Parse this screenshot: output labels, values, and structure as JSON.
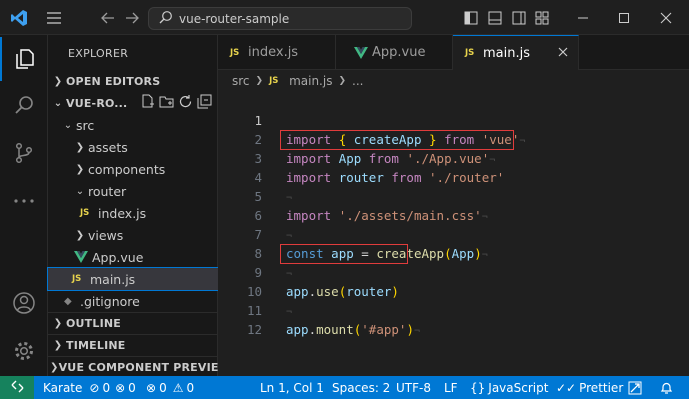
{
  "titlebar": {
    "search_text": "vue-router-sample",
    "icons": [
      "vscode-logo-icon",
      "menu-icon",
      "back-arrow-icon",
      "forward-arrow-icon",
      "search-icon",
      "toggle-sidebar-icon",
      "toggle-panel-icon",
      "toggle-secondary-sidebar-icon",
      "customize-layout-icon",
      "minimize-icon",
      "maximize-icon",
      "close-icon"
    ]
  },
  "activity_bar": {
    "items": [
      "explorer-icon",
      "search-icon",
      "source-control-icon",
      "more-icon",
      "accounts-icon",
      "manage-gear-icon"
    ]
  },
  "sidebar": {
    "title": "EXPLORER",
    "open_editors": "OPEN EDITORS",
    "project": "VUE-RO...",
    "tree": {
      "src": "src",
      "assets": "assets",
      "components": "components",
      "router": "router",
      "index_js": "index.js",
      "views": "views",
      "app_vue": "App.vue",
      "main_js": "main.js",
      "gitignore": ".gitignore"
    },
    "outline": "OUTLINE",
    "timeline": "TIMELINE",
    "vue_preview": "VUE COMPONENT PREVIEW",
    "js_badge": "JS"
  },
  "tabs": [
    {
      "label": "index.js",
      "badge": "JS"
    },
    {
      "label": "App.vue",
      "badge": ""
    },
    {
      "label": "main.js",
      "badge": "JS"
    }
  ],
  "breadcrumb": {
    "folder": "src",
    "file": "main.js",
    "more": "...",
    "badge": "JS"
  },
  "editor": {
    "line_numbers": [
      "1",
      "2",
      "3",
      "4",
      "5",
      "6",
      "7",
      "8",
      "9",
      "10",
      "11",
      "12"
    ],
    "lines": {
      "l1": {
        "kw": "import",
        "brace_open": "{",
        "name": "createApp",
        "brace_close": "}",
        "from": "from",
        "str": "'vue'"
      },
      "l2": {
        "kw": "import",
        "name": "App",
        "from": "from",
        "str": "'./App.vue'"
      },
      "l3": {
        "kw": "import",
        "name": "router",
        "from": "from",
        "str": "'./router'"
      },
      "l5": {
        "kw": "import",
        "str": "'./assets/main.css'"
      },
      "l7": {
        "kw": "const",
        "name": "app",
        "op": "=",
        "fn": "createApp",
        "paren_open": "(",
        "arg": "App",
        "paren_close": ")"
      },
      "l9": {
        "obj": "app",
        "dot": ".",
        "fn": "use",
        "paren_open": "(",
        "arg": "router",
        "paren_close": ")"
      },
      "l11": {
        "obj": "app",
        "dot": ".",
        "fn": "mount",
        "paren_open": "(",
        "str": "'#app'",
        "paren_close": ")"
      }
    },
    "eol_marker": "¬"
  },
  "status_bar": {
    "branch": "Karate",
    "errors": "0",
    "warnings": "0",
    "errors2": "0",
    "warnings2": "0",
    "position": "Ln 1, Col 1",
    "spaces": "Spaces: 2",
    "encoding": "UTF-8",
    "eol": "LF",
    "language": "JavaScript",
    "formatter": "Prettier"
  },
  "colors": {
    "accent": "#0078d4",
    "highlight_box": "#e03c3c",
    "status_bg": "#0078d4"
  }
}
